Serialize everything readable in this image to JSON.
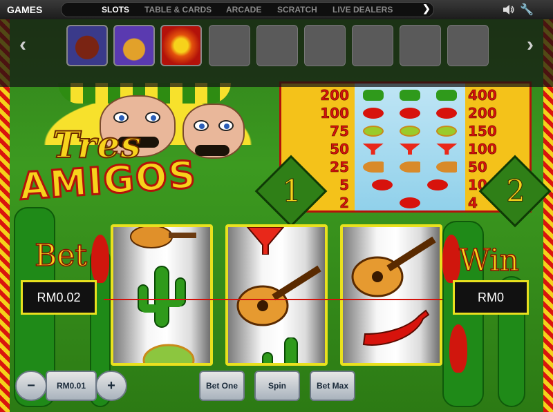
{
  "topbar": {
    "title": "GAMES",
    "nav": [
      "SLOTS",
      "TABLE & CARDS",
      "ARCADE",
      "SCRATCH",
      "LIVE DEALERS"
    ],
    "active_nav": "SLOTS",
    "next_icon": "chevron-right-icon",
    "speaker_icon": "speaker-icon",
    "settings_icon": "wrench-icon"
  },
  "lobby": {
    "thumbnails": [
      {
        "name": "game-thumb-1",
        "state": "filled"
      },
      {
        "name": "game-thumb-2",
        "state": "filled"
      },
      {
        "name": "game-thumb-3",
        "state": "filled"
      },
      {
        "name": "empty-slot",
        "state": "empty"
      },
      {
        "name": "empty-slot",
        "state": "empty"
      },
      {
        "name": "empty-slot",
        "state": "empty"
      },
      {
        "name": "empty-slot",
        "state": "empty"
      },
      {
        "name": "empty-slot",
        "state": "empty"
      },
      {
        "name": "empty-slot",
        "state": "empty"
      }
    ]
  },
  "game": {
    "logo_line1": "Tres",
    "logo_line2": "AMIGOS",
    "paytable": {
      "left": [
        "200",
        "100",
        "75",
        "50",
        "25",
        "5",
        "2"
      ],
      "right": [
        "400",
        "200",
        "150",
        "100",
        "50",
        "10",
        "4"
      ],
      "symbols": [
        "cactus",
        "pepper",
        "maraca",
        "drink",
        "guitar",
        "pepper",
        "pepper"
      ]
    },
    "coin_one": "1",
    "coin_two": "2",
    "bet_label": "Bet",
    "win_label": "Win",
    "bet_value": "RM0.02",
    "win_value": "RM0",
    "reels": [
      [
        "guitar",
        "cactus",
        "maraca"
      ],
      [
        "drink",
        "guitar",
        "cactus"
      ],
      [
        "guitar",
        "pepper"
      ]
    ]
  },
  "controls": {
    "minus": "−",
    "coin_value": "RM0.01",
    "plus": "+",
    "bet_one": "Bet One",
    "spin": "Spin",
    "bet_max": "Bet Max"
  },
  "colors": {
    "accent_yellow": "#f5d21b",
    "chili_red": "#d3120c",
    "felt_green": "#2f7d1a"
  }
}
